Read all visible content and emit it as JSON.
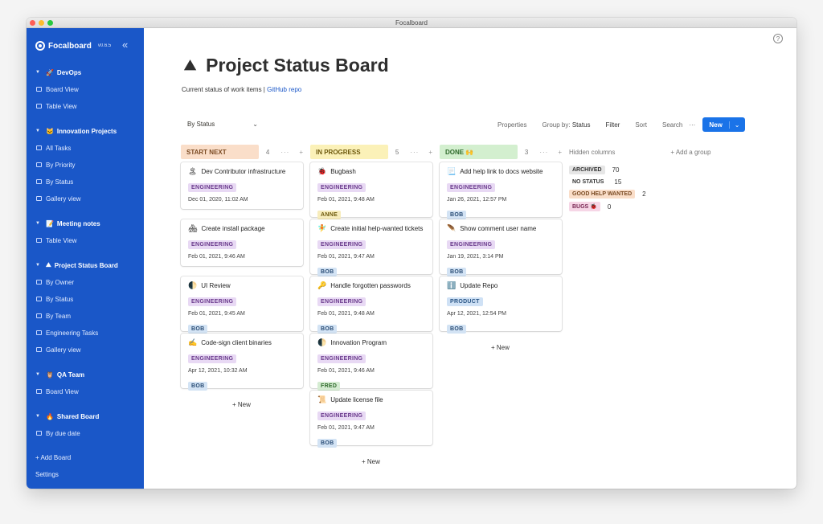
{
  "window": {
    "title": "Focalboard"
  },
  "sidebar": {
    "brand": "Focalboard",
    "version": "v0.6.5",
    "boards": [
      {
        "name": "DevOps",
        "emoji": "🚀",
        "views": [
          "Board View",
          "Table View"
        ]
      },
      {
        "name": "Innovation Projects",
        "emoji": "🐱",
        "views": [
          "All Tasks",
          "By Priority",
          "By Status",
          "Gallery view"
        ]
      },
      {
        "name": "Meeting notes",
        "emoji": "📝",
        "views": [
          "Table View"
        ]
      },
      {
        "name": "Project Status Board",
        "emoji": "⛰",
        "views": [
          "By Owner",
          "By Status",
          "By Team",
          "Engineering Tasks",
          "Gallery view"
        ]
      },
      {
        "name": "QA Team",
        "emoji": "🦉",
        "views": [
          "Board View"
        ]
      },
      {
        "name": "Shared Board",
        "emoji": "🔥",
        "views": [
          "By due date"
        ]
      }
    ],
    "add_board": "+ Add Board",
    "settings": "Settings"
  },
  "page": {
    "icon": "⛰",
    "title": "Project Status Board",
    "description": "Current status of work items | ",
    "link": "GitHub repo"
  },
  "toolbar": {
    "view_name": "By Status",
    "properties": "Properties",
    "group_by_label": "Group by:",
    "group_by_value": "Status",
    "filter": "Filter",
    "sort": "Sort",
    "search": "Search",
    "more": "···",
    "new": "New"
  },
  "columns": [
    {
      "label": "START NEXT",
      "count": "4",
      "color": "#fadec9",
      "text_color": "#7a4a22",
      "cards": [
        {
          "icon": "🏝",
          "title": "Dev Contributor infrastructure",
          "tag": "ENGINEERING",
          "date": "Dec 01, 2020, 11:02 AM",
          "person": ""
        },
        {
          "icon": "🏘",
          "title": "Create install package",
          "tag": "ENGINEERING",
          "date": "Feb 01, 2021, 9:46 AM",
          "person": ""
        },
        {
          "icon": "🌓",
          "title": "UI Review",
          "tag": "ENGINEERING",
          "date": "Feb 01, 2021, 9:45 AM",
          "person": "BOB"
        },
        {
          "icon": "✍",
          "title": "Code-sign client binaries",
          "tag": "ENGINEERING",
          "date": "Apr 12, 2021, 10:32 AM",
          "person": "BOB"
        }
      ]
    },
    {
      "label": "IN PROGRESS",
      "count": "5",
      "color": "#fbf1b8",
      "text_color": "#6e5a0e",
      "cards": [
        {
          "icon": "🐞",
          "title": "Bugbash",
          "tag": "ENGINEERING",
          "date": "Feb 01, 2021, 9:48 AM",
          "person": "ANNE"
        },
        {
          "icon": "🧚",
          "title": "Create initial help-wanted tickets",
          "tag": "ENGINEERING",
          "date": "Feb 01, 2021, 9:47 AM",
          "person": "BOB"
        },
        {
          "icon": "🔑",
          "title": "Handle forgotten passwords",
          "tag": "ENGINEERING",
          "date": "Feb 01, 2021, 9:48 AM",
          "person": "BOB"
        },
        {
          "icon": "🌓",
          "title": "Innovation Program",
          "tag": "ENGINEERING",
          "date": "Feb 01, 2021, 9:46 AM",
          "person": "FRED"
        },
        {
          "icon": "📜",
          "title": "Update license file",
          "tag": "ENGINEERING",
          "date": "Feb 01, 2021, 9:47 AM",
          "person": "BOB"
        }
      ]
    },
    {
      "label": "DONE 🙌",
      "count": "3",
      "color": "#d3efcf",
      "text_color": "#2f6a2b",
      "cards": [
        {
          "icon": "📃",
          "title": "Add help link to docs website",
          "tag": "ENGINEERING",
          "date": "Jan 26, 2021, 12:57 PM",
          "person": "BOB"
        },
        {
          "icon": "🪶",
          "title": "Show comment user name",
          "tag": "ENGINEERING",
          "date": "Jan 19, 2021, 3:14 PM",
          "person": "BOB"
        },
        {
          "icon": "ℹ️",
          "title": "Update Repo",
          "tag": "PRODUCT",
          "date": "Apr 12, 2021, 12:54 PM",
          "person": "BOB"
        }
      ]
    }
  ],
  "add_new": "+ New",
  "hidden": {
    "label": "Hidden columns",
    "add_group": "+ Add a group",
    "groups": [
      {
        "label": "ARCHIVED",
        "count": "70",
        "color": "#e6e6e6",
        "text_color": "#333"
      },
      {
        "label": "NO STATUS",
        "count": "15",
        "color": "transparent",
        "text_color": "#333"
      },
      {
        "label": "GOOD HELP WANTED",
        "count": "2",
        "color": "#fadec9",
        "text_color": "#7a4a22"
      },
      {
        "label": "BUGS 🐞",
        "count": "0",
        "color": "#f6d6e6",
        "text_color": "#7a2a55"
      }
    ]
  }
}
